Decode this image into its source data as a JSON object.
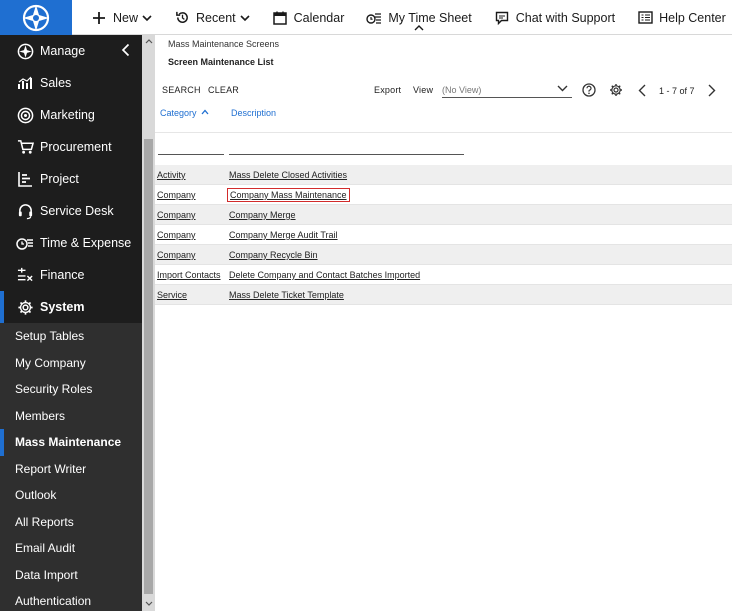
{
  "topnav": {
    "new_label": "New",
    "recent_label": "Recent",
    "calendar_label": "Calendar",
    "timesheet_label": "My Time Sheet",
    "chat_label": "Chat with Support",
    "help_label": "Help Center"
  },
  "sidebar": {
    "sections": [
      {
        "label": "Manage",
        "icon": "compass-icon"
      },
      {
        "label": "Sales",
        "icon": "chart-icon"
      },
      {
        "label": "Marketing",
        "icon": "target-icon"
      },
      {
        "label": "Procurement",
        "icon": "cart-icon"
      },
      {
        "label": "Project",
        "icon": "project-icon"
      },
      {
        "label": "Service Desk",
        "icon": "headset-icon"
      },
      {
        "label": "Time & Expense",
        "icon": "timer-icon"
      },
      {
        "label": "Finance",
        "icon": "finance-icon"
      },
      {
        "label": "System",
        "icon": "gear-icon"
      }
    ],
    "sub_items": [
      "Setup Tables",
      "My Company",
      "Security Roles",
      "Members",
      "Mass Maintenance",
      "Report Writer",
      "Outlook",
      "All Reports",
      "Email Audit",
      "Data Import",
      "Authentication"
    ]
  },
  "content": {
    "breadcrumb": "Mass Maintenance Screens",
    "title": "Screen Maintenance List",
    "toolbar": {
      "search": "SEARCH",
      "clear": "CLEAR",
      "export": "Export",
      "view": "View",
      "view_value": "(No View)",
      "pager": "1 - 7 of 7"
    },
    "columns": {
      "category": "Category",
      "description": "Description"
    },
    "rows": [
      {
        "category": "Activity",
        "description": "Mass Delete Closed Activities"
      },
      {
        "category": "Company",
        "description": "Company Mass Maintenance"
      },
      {
        "category": "Company",
        "description": "Company Merge"
      },
      {
        "category": "Company",
        "description": "Company Merge Audit Trail"
      },
      {
        "category": "Company",
        "description": "Company Recycle Bin"
      },
      {
        "category": "Import Contacts",
        "description": "Delete Company and Contact Batches Imported"
      },
      {
        "category": "Service",
        "description": "Mass Delete Ticket Template"
      }
    ]
  },
  "colors": {
    "brand_blue": "#1f6fd1",
    "sidebar_dark": "#1d1d1d",
    "highlight_red": "#d22b2b"
  }
}
